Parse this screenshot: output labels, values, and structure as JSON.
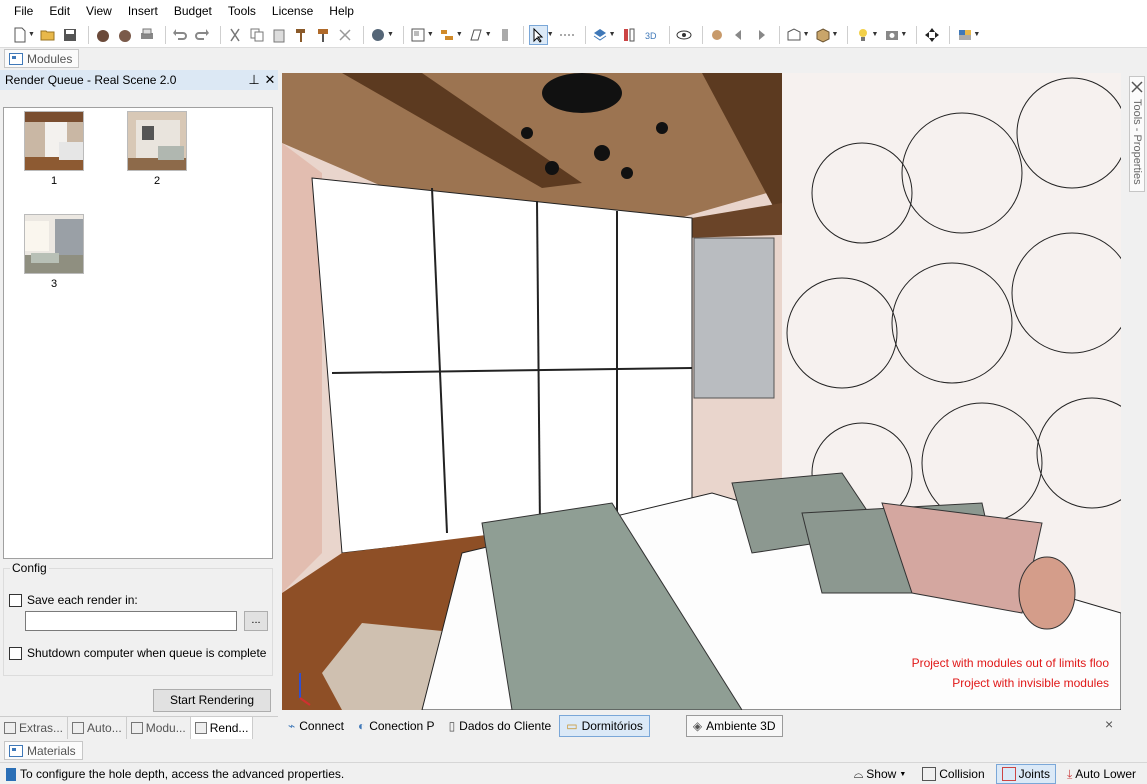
{
  "menu": [
    "File",
    "Edit",
    "View",
    "Insert",
    "Budget",
    "Tools",
    "License",
    "Help"
  ],
  "modules_tab": "Modules",
  "render_queue": {
    "title": "Render Queue - Real Scene 2.0",
    "pin_icon": "pin-icon",
    "close_icon": "close-icon",
    "items": [
      {
        "label": "1"
      },
      {
        "label": "2"
      },
      {
        "label": "3"
      }
    ]
  },
  "config": {
    "title": "Config",
    "save_each_render": "Save each render in:",
    "path_value": "",
    "browse": "...",
    "shutdown": "Shutdown computer when queue is complete",
    "start_button": "Start Rendering"
  },
  "left_tabs": [
    "Extras...",
    "Auto...",
    "Modu...",
    "Rend..."
  ],
  "right_tab": "Tools - Properties",
  "viewport": {
    "warnings": [
      "Project with modules out of limits floo",
      "Project with invisible modules"
    ]
  },
  "doc_tabs": [
    "Connect",
    "Conection P",
    "Dados do Cliente",
    "Dormitórios",
    "Ambiente 3D"
  ],
  "doc_close": "×",
  "materials_tab": "Materials",
  "status": {
    "text": "To configure the hole depth, access the advanced properties.",
    "buttons": [
      "Show",
      "Collision",
      "Joints",
      "Auto Lower"
    ]
  },
  "colors": {
    "accent": "#dbe9f7",
    "accent_border": "#7aa7d8",
    "warning": "#e01818"
  }
}
